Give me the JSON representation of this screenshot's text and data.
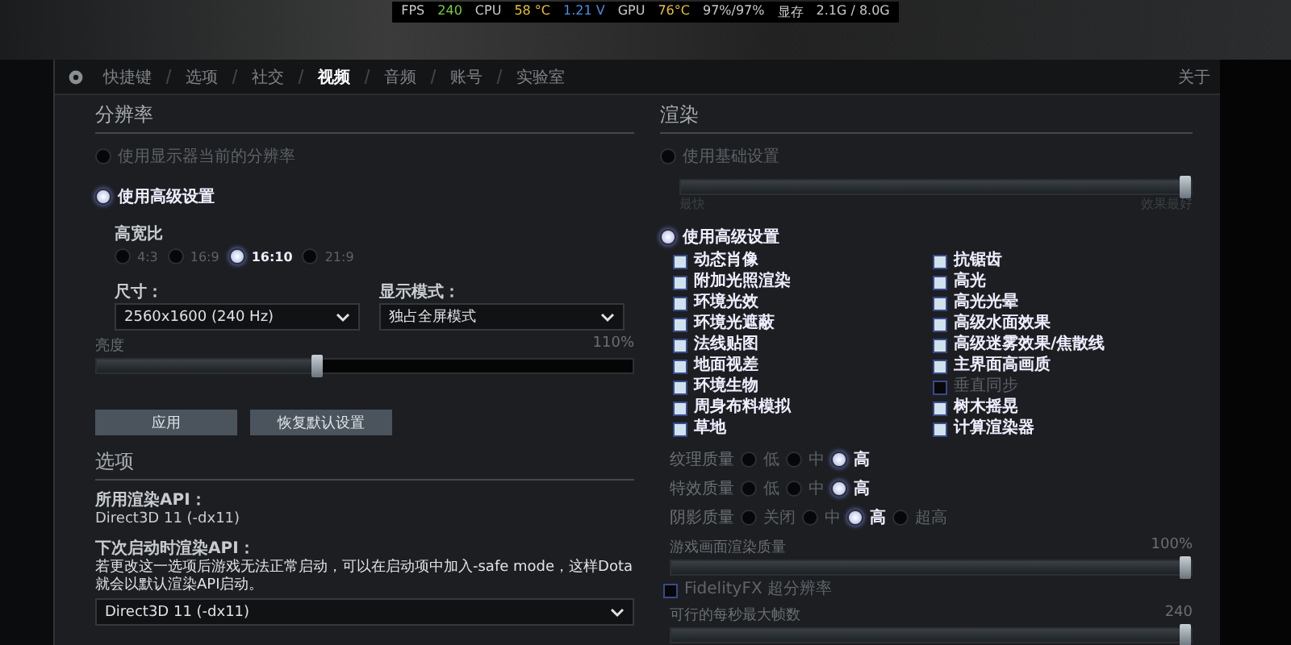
{
  "hud": [
    {
      "text": "FPS",
      "color": "#c8c8c8"
    },
    {
      "text": "240",
      "color": "#7ccc3c"
    },
    {
      "text": "CPU",
      "color": "#c8c8c8"
    },
    {
      "text": "58 °C",
      "color": "#e6c232"
    },
    {
      "text": "1.21 V",
      "color": "#4a8fe0"
    },
    {
      "text": "GPU",
      "color": "#c8c8c8"
    },
    {
      "text": "76°C",
      "color": "#e6c232"
    },
    {
      "text": "97%/97%",
      "color": "#c8c8c8"
    },
    {
      "text": "显存",
      "color": "#c8c8c8"
    },
    {
      "text": "2.1G / 8.0G",
      "color": "#c8c8c8"
    }
  ],
  "tabs": [
    {
      "label": "快捷键",
      "selected": false
    },
    {
      "label": "选项",
      "selected": false
    },
    {
      "label": "社交",
      "selected": false
    },
    {
      "label": "视频",
      "selected": true
    },
    {
      "label": "音频",
      "selected": false
    },
    {
      "label": "账号",
      "selected": false
    },
    {
      "label": "实验室",
      "selected": false
    }
  ],
  "about_link": "关于",
  "resolution": {
    "title": "分辨率",
    "modes": [
      {
        "label": "使用显示器当前的分辨率",
        "selected": false
      },
      {
        "label": "使用高级设置",
        "selected": true
      }
    ],
    "aspect_ratio": {
      "label": "高宽比",
      "options": [
        {
          "label": "4:3",
          "selected": false
        },
        {
          "label": "16:9",
          "selected": false
        },
        {
          "label": "16:10",
          "selected": true
        },
        {
          "label": "21:9",
          "selected": false
        }
      ]
    },
    "size": {
      "label": "尺寸：",
      "value": "2560x1600 (240 Hz)"
    },
    "display_mode": {
      "label": "显示模式：",
      "value": "独占全屏模式"
    },
    "brightness": {
      "label": "亮度",
      "reading": "110%",
      "level": 0.41
    }
  },
  "buttons": [
    "应用",
    "恢复默认设置"
  ],
  "options": {
    "title": "选项",
    "render_api_label": "所用渲染API：",
    "render_api_value": "Direct3D 11 (-dx11)",
    "next_api_label": "下次启动时渲染API：",
    "next_api_note": "若更改这一选项后游戏无法正常启动，可以在启动项中加入-safe mode，这样Dota就会以默认渲染API启动。",
    "next_api": {
      "value": "Direct3D 11 (-dx11)"
    }
  },
  "rendering": {
    "title": "渲染",
    "basic": {
      "label": "使用基础设置",
      "selected": false
    },
    "basic_slider": {
      "level": 1,
      "min_label": "最快",
      "max_label": "效果最好"
    },
    "advanced": {
      "label": "使用高级设置",
      "selected": true
    },
    "checkboxes": [
      {
        "label": "动态肖像",
        "checked": true
      },
      {
        "label": "抗锯齿",
        "checked": true
      },
      {
        "label": "附加光照渲染",
        "checked": true
      },
      {
        "label": "高光",
        "checked": true
      },
      {
        "label": "环境光效",
        "checked": true
      },
      {
        "label": "高光光晕",
        "checked": true
      },
      {
        "label": "环境光遮蔽",
        "checked": true
      },
      {
        "label": "高级水面效果",
        "checked": true
      },
      {
        "label": "法线贴图",
        "checked": true
      },
      {
        "label": "高级迷雾效果/焦散线",
        "checked": true
      },
      {
        "label": "地面视差",
        "checked": true
      },
      {
        "label": "主界面高画质",
        "checked": true
      },
      {
        "label": "环境生物",
        "checked": true
      },
      {
        "label": "垂直同步",
        "checked": false
      },
      {
        "label": "周身布料模拟",
        "checked": true
      },
      {
        "label": "树木摇晃",
        "checked": true
      },
      {
        "label": "草地",
        "checked": true
      },
      {
        "label": "计算渲染器",
        "checked": true
      }
    ],
    "quality": [
      {
        "label": "纹理质量",
        "options": [
          {
            "label": "低",
            "selected": false
          },
          {
            "label": "中",
            "selected": false
          },
          {
            "label": "高",
            "selected": true
          }
        ]
      },
      {
        "label": "特效质量",
        "options": [
          {
            "label": "低",
            "selected": false
          },
          {
            "label": "中",
            "selected": false
          },
          {
            "label": "高",
            "selected": true
          }
        ]
      },
      {
        "label": "阴影质量",
        "options": [
          {
            "label": "关闭",
            "selected": false
          },
          {
            "label": "中",
            "selected": false
          },
          {
            "label": "高",
            "selected": true
          },
          {
            "label": "超高",
            "selected": false
          }
        ]
      }
    ],
    "render_quality": {
      "label": "游戏画面渲染质量",
      "reading": "100%",
      "level": 1
    },
    "fsr": {
      "label": "FidelityFX 超分辨率",
      "checked": false
    },
    "max_fps": {
      "label": "可行的每秒最大帧数",
      "reading": "240",
      "level": 1
    }
  }
}
